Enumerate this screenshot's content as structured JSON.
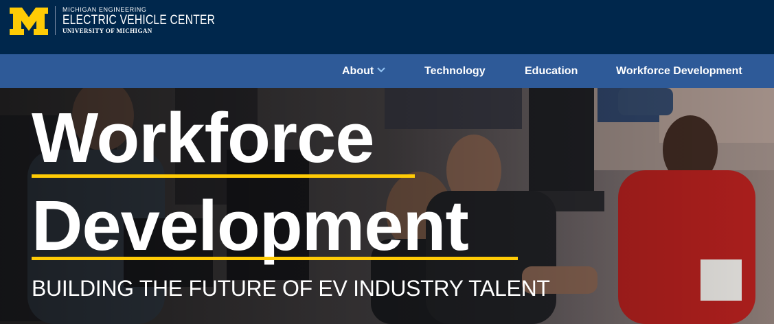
{
  "header": {
    "logo_top": "MICHIGAN ENGINEERING",
    "logo_main": "ELECTRIC VEHICLE CENTER",
    "logo_bottom": "UNIVERSITY OF MICHIGAN",
    "logo_icon": "block-m-logo",
    "colors": {
      "navy": "#00274c",
      "maize": "#ffcb05",
      "nav_blue": "#2e5a98"
    }
  },
  "nav": {
    "items": [
      {
        "label": "About",
        "has_dropdown": true
      },
      {
        "label": "Technology"
      },
      {
        "label": "Education"
      },
      {
        "label": "Workforce Development"
      }
    ],
    "dropdown_icon": "chevron-down-icon"
  },
  "hero": {
    "title_line_1": "Workforce",
    "title_line_2": "Development",
    "subtitle": "BUILDING THE FUTURE OF EV INDUSTRY TALENT",
    "background": "photo of people seated at computer workstations in a training classroom"
  }
}
